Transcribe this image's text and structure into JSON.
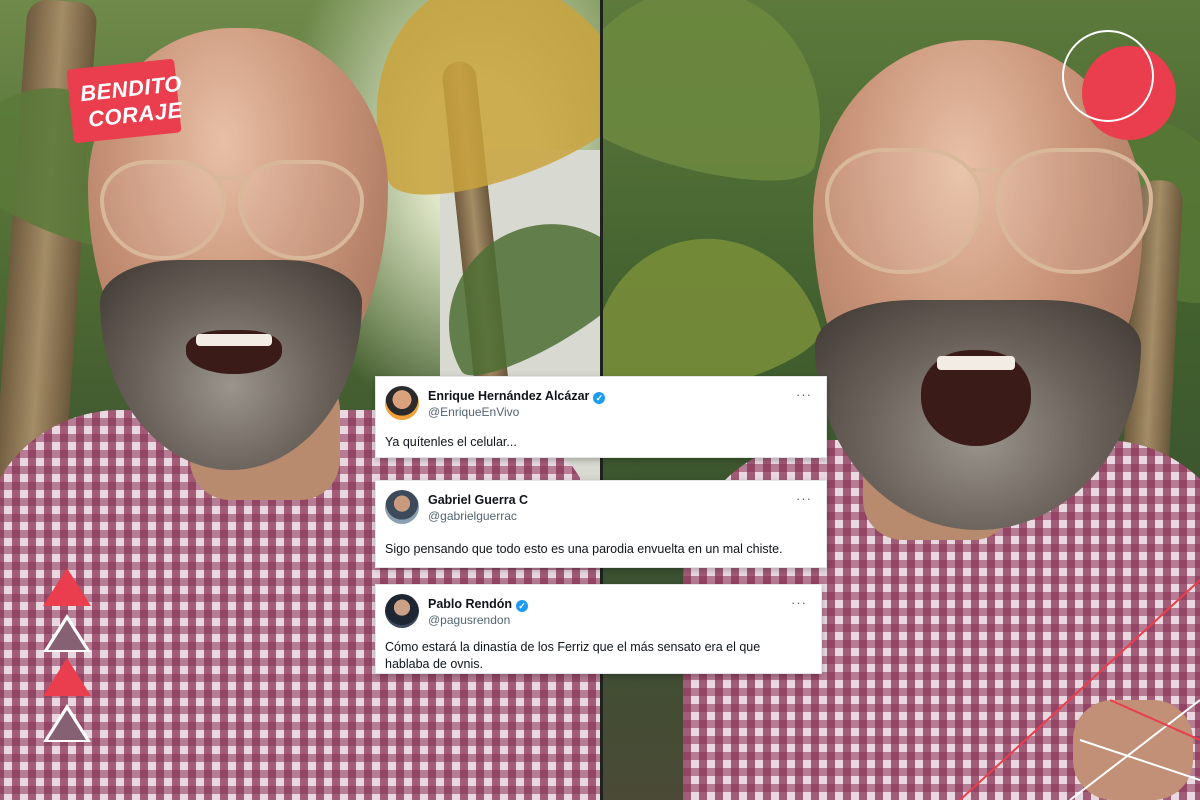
{
  "logo": {
    "line1": "BENDITO",
    "line2": "CORAJE"
  },
  "tweets": [
    {
      "name": "Enrique Hernández Alcázar",
      "handle": "@EnriqueEnVivo",
      "verified": true,
      "text": "Ya quítenles el celular...",
      "more": "···"
    },
    {
      "name": "Gabriel Guerra C",
      "handle": "@gabrielguerrac",
      "verified": false,
      "text": "Sigo pensando que todo esto es una parodia envuelta en un mal chiste.",
      "more": "···"
    },
    {
      "name": "Pablo Rendón",
      "handle": "@pagusrendon",
      "verified": true,
      "text": "Cómo estará la dinastía de los Ferriz que el más sensato era el que hablaba de ovnis.",
      "more": "···"
    }
  ],
  "colors": {
    "accent": "#ea3d4d",
    "verified": "#1d9bf0",
    "shirt": "#8a3254"
  },
  "icons": {
    "verified": "verified-badge-icon",
    "more": "more-options-icon"
  }
}
